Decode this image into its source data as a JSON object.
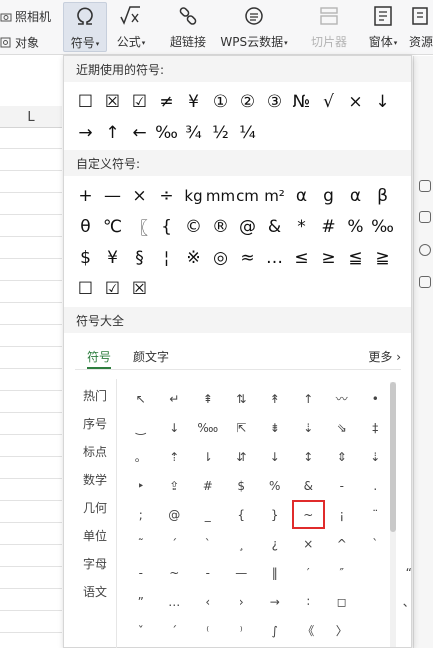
{
  "ribbon": {
    "camera_label": "照相机",
    "object_label": "对象",
    "symbol_label": "符号",
    "formula_label": "公式",
    "hyperlink_label": "超链接",
    "wps_cloud_label": "WPS云数据",
    "slicer_label": "切片器",
    "window_label": "窗体",
    "resource_label": "资源"
  },
  "sheet": {
    "column_label": "L"
  },
  "panel": {
    "recent_title": "近期使用的符号:",
    "recent": [
      "☐",
      "☒",
      "☑",
      "≠",
      "¥",
      "①",
      "②",
      "③",
      "№",
      "√",
      "×",
      "↓",
      "→",
      "↑",
      "←",
      "‰",
      "¾",
      "½",
      "¼"
    ],
    "custom_title": "自定义符号:",
    "custom": [
      "+",
      "—",
      "×",
      "÷",
      "kg",
      "mm",
      "cm",
      "m²",
      "α",
      "g",
      "α",
      "β",
      "θ",
      "℃",
      "〖",
      "{",
      "©",
      "®",
      "@",
      "&",
      "*",
      "#",
      "%",
      "‰",
      "$",
      "¥",
      "§",
      "¦",
      "※",
      "◎",
      "≈",
      "…",
      "≤",
      "≥",
      "≦",
      "≧",
      "☐",
      "☑",
      "☒"
    ],
    "all_title": "符号大全",
    "tab_symbols": "符号",
    "tab_emoticons": "颜文字",
    "more_label": "更多",
    "categories": [
      "热门",
      "序号",
      "标点",
      "数学",
      "几何",
      "单位",
      "字母",
      "语文"
    ],
    "symbols": [
      "↖",
      "↵",
      "⇞",
      "⇅",
      "↟",
      "↑",
      "〰",
      "•",
      "",
      "‿",
      "↓",
      "‱",
      "⇱",
      "⇟",
      "⇣",
      "⇘",
      "‡",
      "",
      "。",
      "⇡",
      "⇂",
      "⇵",
      "↓",
      "↕",
      "⇕",
      "⇣",
      "",
      "‣",
      "⇪",
      "#",
      "$",
      "%",
      "&",
      "-",
      ".",
      "",
      ";",
      "@",
      "_",
      "{",
      "}",
      "~",
      "¡",
      "¨",
      "",
      "˜",
      "ˊ",
      "ˋ",
      "¸",
      "¿",
      "×",
      "^",
      "`",
      "",
      "-",
      "~",
      "-",
      "—",
      "‖",
      "′",
      "″",
      "",
      "“",
      "”",
      "…",
      "‹",
      "›",
      "→",
      "∶",
      "◻",
      "",
      "、",
      "ˇ",
      "ˊ",
      "⁽",
      "⁾",
      "∫",
      "《",
      "〉",
      ""
    ],
    "selected_symbol": "~"
  }
}
